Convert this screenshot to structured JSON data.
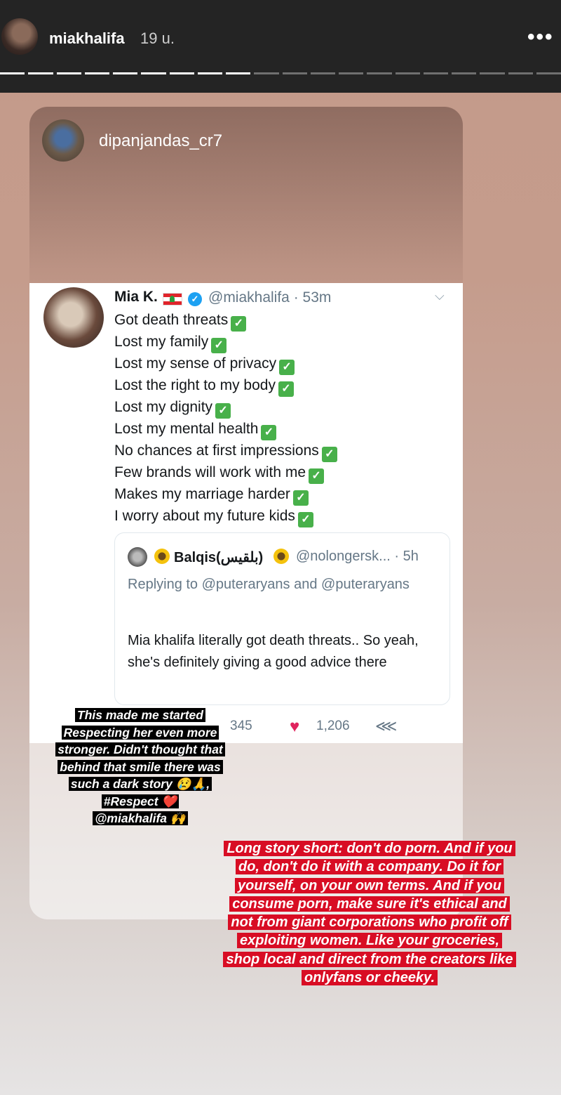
{
  "story_header": {
    "username": "miakhalifa",
    "time": "19 u.",
    "more_icon": "more-horizontal-icon",
    "segments_total": 20,
    "segments_viewed": 9
  },
  "reposted": {
    "username": "dipanjandas_cr7"
  },
  "tweet": {
    "name": "Mia K.",
    "flag": "lebanon-flag-icon",
    "verified_icon": "verified-badge-icon",
    "handle_time": "@miakhalifa · 53m",
    "lines": [
      "Got death threats",
      "Lost my family",
      "Lost my sense of privacy",
      "Lost the right to my body",
      "Lost my dignity",
      "Lost my mental health",
      "No chances at first impressions",
      "Few brands will work with me",
      "Makes my marriage harder",
      "I worry about my future kids"
    ],
    "check_glyph": "✓",
    "quote": {
      "name": "Balqis(بلقيس)",
      "handle_time": "@nolongersk... · 5h",
      "replying_to": "Replying to @puteraryans and @puteraryans",
      "text": "Mia khalifa literally got death threats.. So yeah, she's definitely giving a good advice there"
    },
    "actions": {
      "retweets": "345",
      "likes": "1,206"
    }
  },
  "sticker_text": {
    "lines": [
      "This made me started",
      "Respecting her even more",
      "stronger. Didn't thought that",
      "behind that smile there was",
      "such a dark story 😢🙏,",
      "#Respect ❤️",
      "@miakhalifa 🙌"
    ]
  },
  "caption": {
    "lines": [
      "Long story short: don't do porn. And if you",
      "do, don't do it with a company. Do it for",
      "yourself, on your own terms. And if you",
      "consume porn, make sure it's ethical and",
      "not from giant corporations who profit off",
      "exploiting women. Like your groceries,",
      "shop local and direct from the creators like",
      "onlyfans or cheeky."
    ]
  },
  "colors": {
    "caption_bg": "#d80d24",
    "verified": "#1da1f2",
    "like": "#e0245e",
    "check": "#48b04a"
  }
}
